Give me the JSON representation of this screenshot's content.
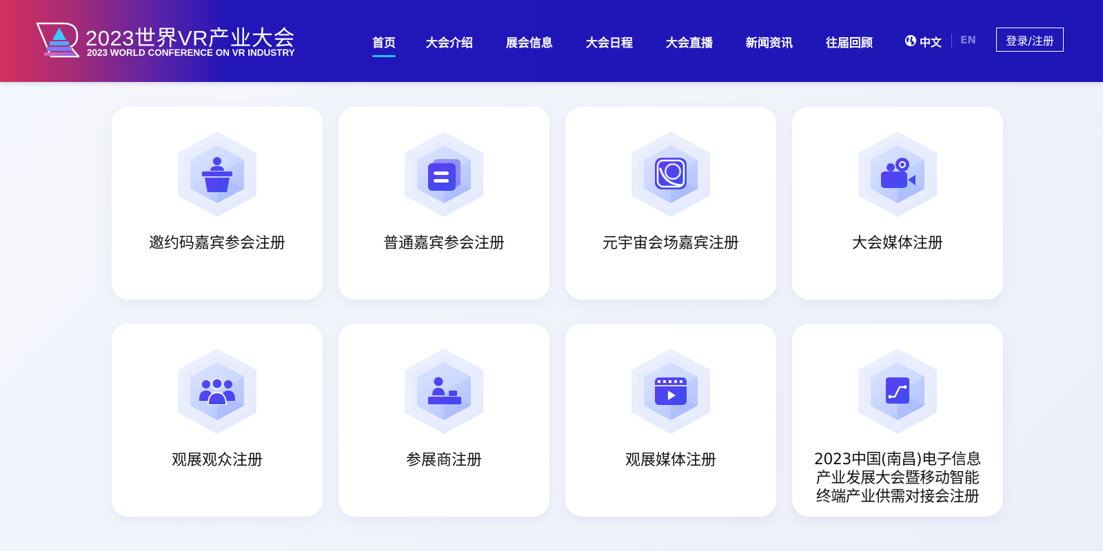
{
  "header": {
    "logo": {
      "title": "2023世界VR产业大会",
      "subtitle": "2023 WORLD CONFERENCE ON VR INDUSTRY"
    },
    "nav": [
      {
        "label": "首页",
        "active": true
      },
      {
        "label": "大会介绍",
        "active": false
      },
      {
        "label": "展会信息",
        "active": false
      },
      {
        "label": "大会日程",
        "active": false
      },
      {
        "label": "大会直播",
        "active": false
      },
      {
        "label": "新闻资讯",
        "active": false
      },
      {
        "label": "往届回顾",
        "active": false
      }
    ],
    "language": {
      "current": "中文",
      "other": "EN"
    },
    "login_label": "登录/注册"
  },
  "cards": [
    {
      "label": "邀约码嘉宾参会注册",
      "icon": "podium-icon"
    },
    {
      "label": "普通嘉宾参会注册",
      "icon": "cards-icon"
    },
    {
      "label": "元宇宙会场嘉宾注册",
      "icon": "planet-icon"
    },
    {
      "label": "大会媒体注册",
      "icon": "video-camera-icon"
    },
    {
      "label": "观展观众注册",
      "icon": "people-group-icon"
    },
    {
      "label": "参展商注册",
      "icon": "exhibitor-icon"
    },
    {
      "label": "观展媒体注册",
      "icon": "video-player-icon"
    },
    {
      "label": "2023中国(南昌)电子信息产业发展大会暨移动智能终端产业供需对接会注册",
      "label_lines": [
        "2023中国(南昌)电子信息",
        "产业发展大会暨移动智能",
        "终端产业供需对接会注册"
      ],
      "icon": "chip-icon"
    }
  ],
  "colors": {
    "header_bg": "#1e16b6",
    "header_accent_left": "#d2305e",
    "nav_active_underline": "#19c6f2",
    "icon_primary": "#4b3cf0"
  }
}
